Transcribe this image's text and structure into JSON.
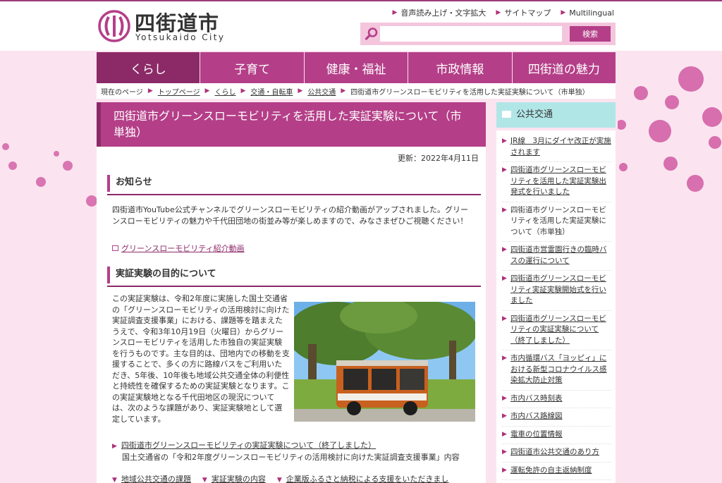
{
  "header": {
    "logo_jp": "四街道市",
    "logo_en": "Yotsukaido City",
    "util_links": [
      "音声読み上げ・文字拡大",
      "サイトマップ",
      "Multilingual"
    ],
    "search_placeholder": "",
    "search_button": "検索"
  },
  "nav": {
    "items": [
      {
        "label": "くらし",
        "active": true
      },
      {
        "label": "子育て"
      },
      {
        "label": "健康・福祉"
      },
      {
        "label": "市政情報"
      },
      {
        "label": "四街道の魅力"
      }
    ]
  },
  "breadcrumb": {
    "current_label": "現在のページ",
    "items": [
      "トップページ",
      "くらし",
      "交通・自転車",
      "公共交通"
    ],
    "current": "四街道市グリーンスローモビリティを活用した実証実験について（市単独）"
  },
  "page": {
    "title": "四街道市グリーンスローモビリティを活用した実証実験について（市単独）",
    "updated": "更新：2022年4月11日",
    "notice_heading": "お知らせ",
    "notice_text": "四街道市YouTube公式チャンネルでグリーンスローモビリティの紹介動画がアップされました。グリーンスローモビリティの魅力や千代田団地の街並み等が楽しめますので、みなさまぜひご視聴ください！",
    "video_link": "グリーンスローモビリティ紹介動画",
    "purpose_heading": "実証実験の目的について",
    "purpose_text": "この実証実験は、令和2年度に実施した国土交通省の「グリーンスローモビリティの活用検討に向けた実証調査支援事業」における、課題等を踏まえたうえで、令和3年10月19日（火曜日）からグリーンスローモビリティを活用した市独自の実証実験を行うものです。主な目的は、団地内での移動を支援することで、多くの方に路線バスをご利用いただき、5年後、10年後も地域公共交通全体の利便性と持続性を確保するための実証実験となります。この実証実験地となる千代田地区の現況については、次のような課題があり、実証実験地として選定しています。",
    "related_link": "四街道市グリーンスローモビリティの実証実験について（終了しました）",
    "related_note": "国土交通省の「令和2年度グリーンスローモビリティの活用検討に向けた実証調査支援事業」内容",
    "anchors": [
      "地域公共交通の課題",
      "実証実験の内容",
      "企業版ふるさと納税による支援をいただきまし"
    ]
  },
  "sidebar": {
    "heading": "公共交通",
    "items": [
      "JR線　3月にダイヤ改正が実施されます",
      "四街道市グリーンスローモビリティを活用した実証実験出発式を行いました",
      "四街道市グリーンスローモビリティを活用した実証実験について（市単独）",
      "四街道市営霊園行きの臨時バスの運行について",
      "四街道市グリーンスローモビリティ実証実験開始式を行いました",
      "四街道市グリーンスローモビリティの実証実験について（終了しました）",
      "市内循環バス「ヨッピィ」における新型コロナウイルス感染拡大防止対策",
      "市内バス時刻表",
      "市内バス路線図",
      "電車の位置情報",
      "四街道市公共交通のあり方",
      "運転免許の自主返納制度"
    ]
  },
  "colors": {
    "brand": "#b43f88",
    "brand_dark": "#8c2a68",
    "bg": "#fbe4ef",
    "side_header": "#b1e6e7"
  }
}
